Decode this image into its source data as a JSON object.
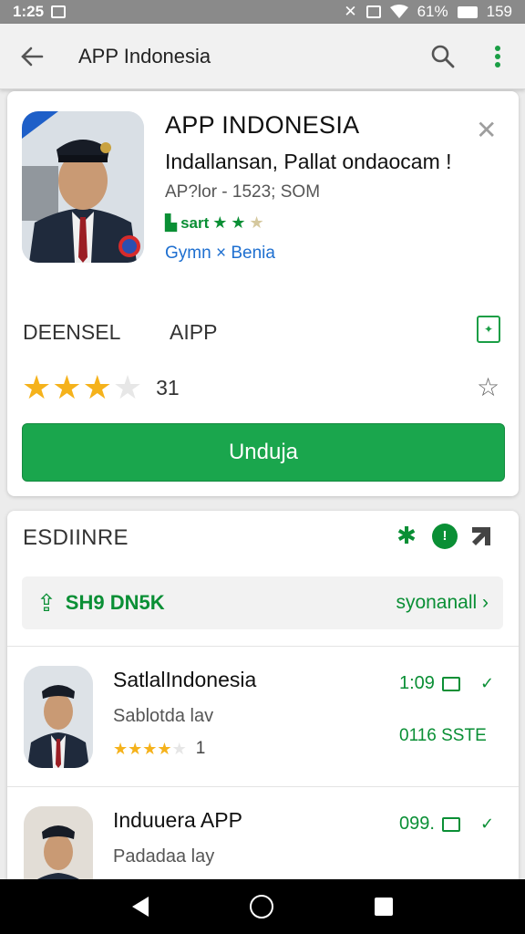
{
  "status_bar": {
    "time": "1:25",
    "battery_text": "61%",
    "right_time": "159"
  },
  "app_bar": {
    "title": "APP Indonesia"
  },
  "app_card": {
    "name": "APP INDONESIA",
    "developer": "Indallansan, Pallat ondaocam !",
    "meta": "AP?lor - 1523; SOM",
    "small_rating_label": "sart",
    "tags": "Gymn × Benia",
    "tab_left": "DEENSEL",
    "tab_right": "AIPP",
    "rating_stars": 3,
    "rating_count": "31",
    "install_label": "Unduja"
  },
  "section": {
    "title": "ESDIINRE",
    "update_label": "SH9 DN5K",
    "update_link": "syonanall"
  },
  "list": [
    {
      "title": "SatlalIndonesia",
      "subtitle": "Sablotda lav",
      "stars": 4,
      "count": "1",
      "time": "1:09",
      "size": "0116 SSTE"
    },
    {
      "title": "Induuera APP",
      "subtitle": "Padadaa lay",
      "time": "099."
    }
  ],
  "colors": {
    "accent_green": "#1aa64d",
    "star_yellow": "#f5b21b",
    "link_blue": "#1e6fd0"
  }
}
